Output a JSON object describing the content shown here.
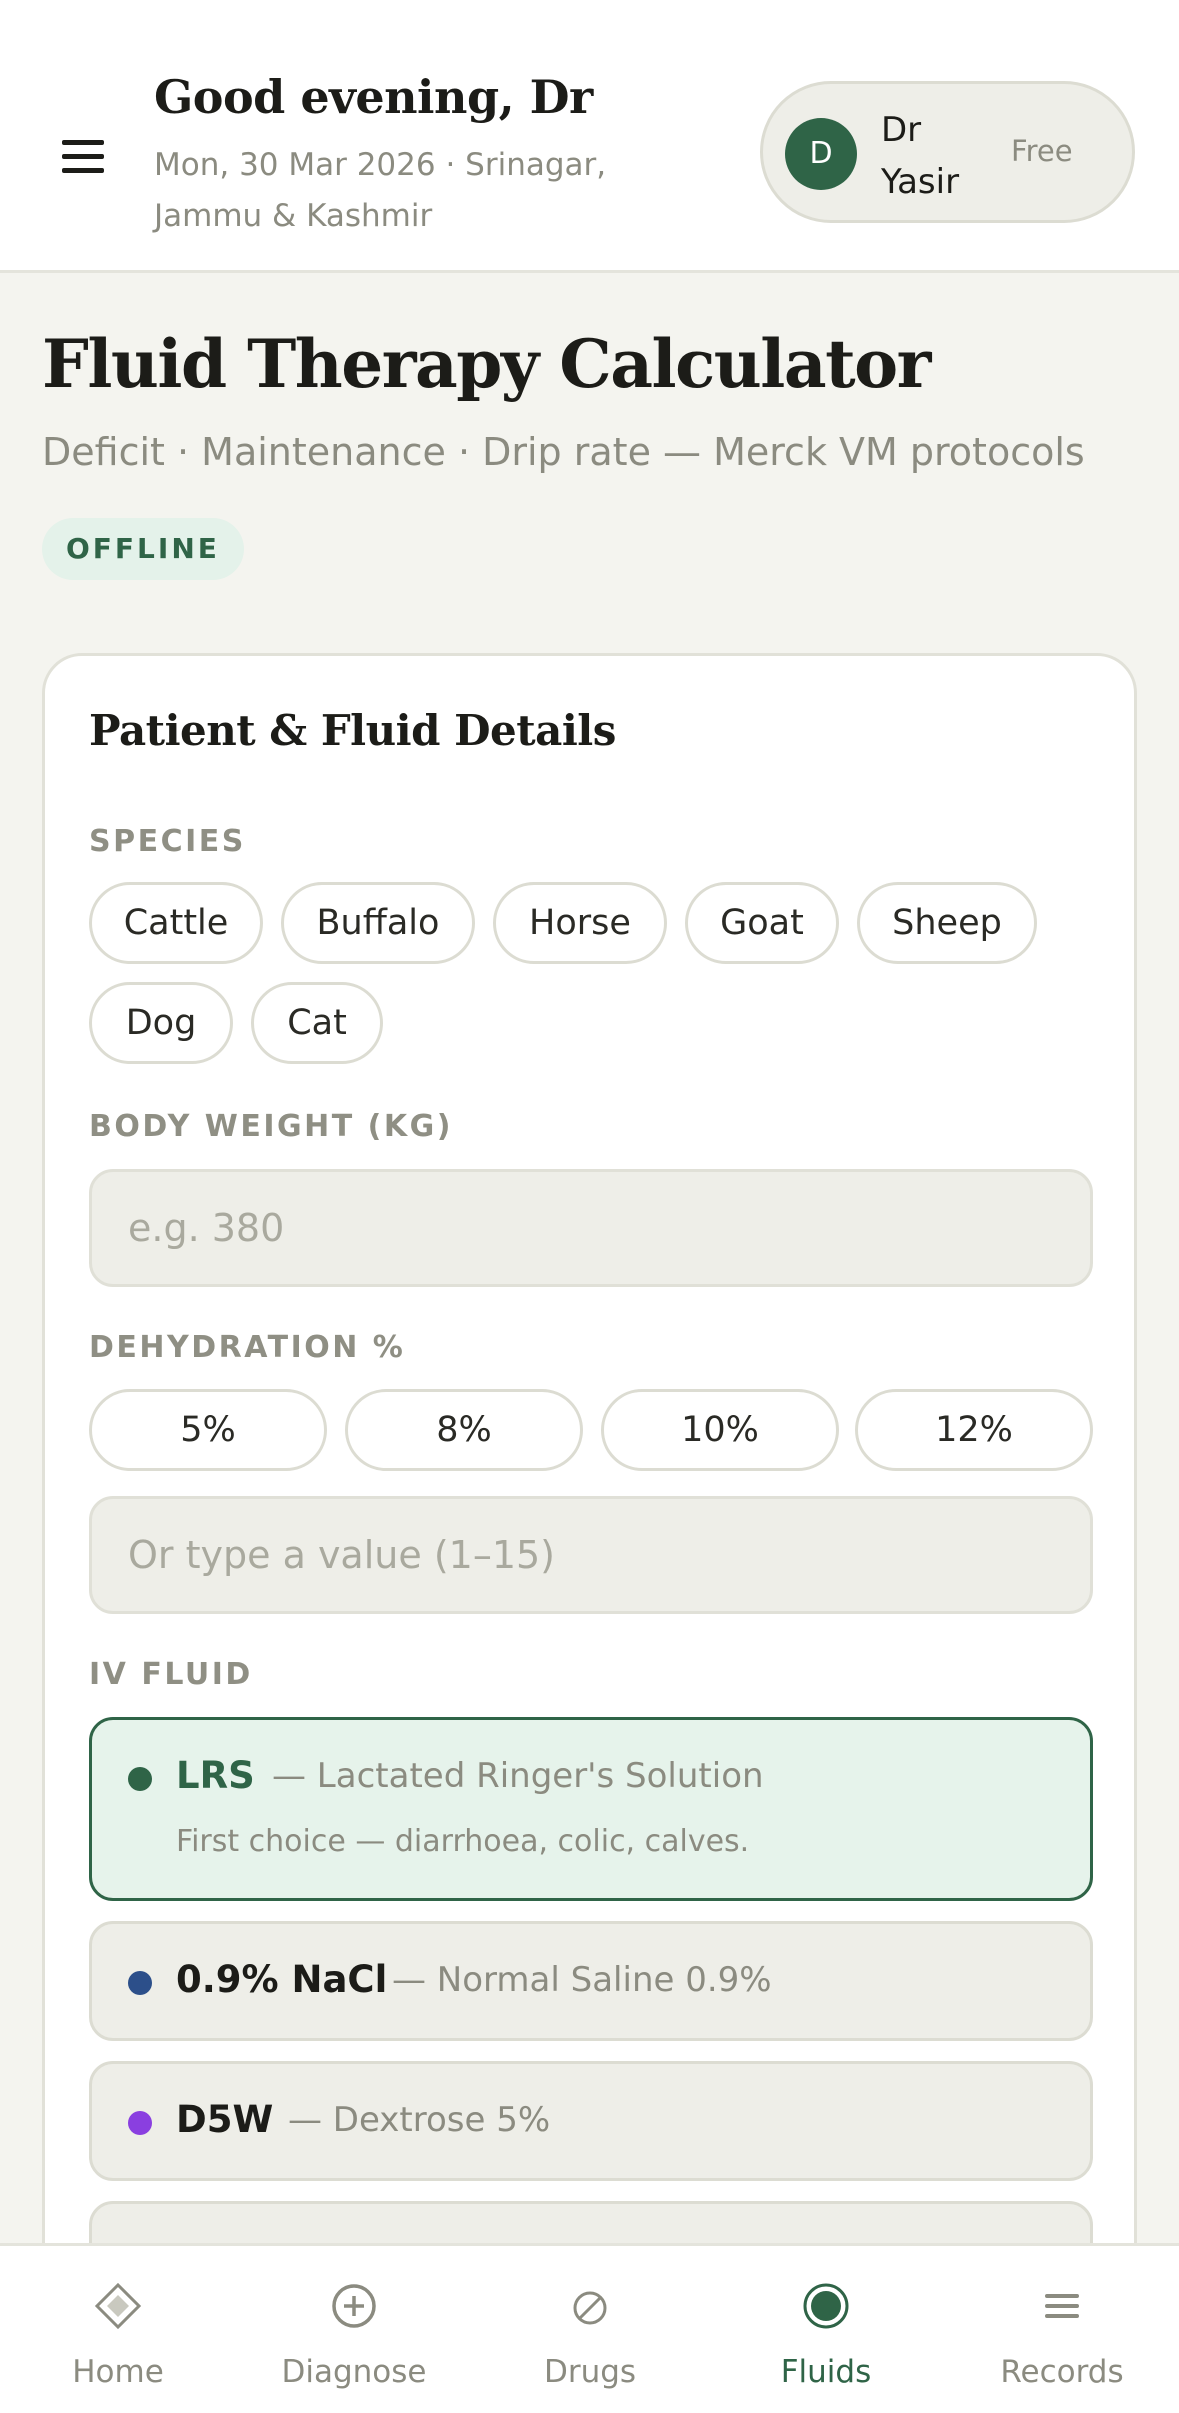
{
  "header": {
    "greeting": "Good evening, Dr",
    "subtitle": "Mon, 30 Mar 2026 · Srinagar, Jammu & Kashmir",
    "profile": {
      "initial": "D",
      "name": "Dr Yasir",
      "plan": "Free"
    }
  },
  "page": {
    "title": "Fluid Therapy Calculator",
    "subtitle": "Deficit · Maintenance · Drip rate — Merck VM protocols",
    "status_badge": "OFFLINE"
  },
  "form": {
    "title": "Patient & Fluid Details",
    "species_label": "SPECIES",
    "species": [
      "Cattle",
      "Buffalo",
      "Horse",
      "Goat",
      "Sheep",
      "Dog",
      "Cat"
    ],
    "weight_label": "BODY WEIGHT (KG)",
    "weight_placeholder": "e.g. 380",
    "dehydration_label": "DEHYDRATION %",
    "dehydration_options": [
      "5%",
      "8%",
      "10%",
      "12%"
    ],
    "dehydration_placeholder": "Or type a value (1–15)",
    "fluid_label": "IV FLUID",
    "fluids": [
      {
        "name": "LRS",
        "desc": "— Lactated Ringer's Solution",
        "note": "First choice — diarrhoea, colic, calves.",
        "color": "#2f6447",
        "selected": true
      },
      {
        "name": "0.9% NaCl",
        "desc": "— Normal Saline 0.9%",
        "color": "#2c4f8a"
      },
      {
        "name": "D5W",
        "desc": "— Dextrose 5%",
        "color": "#8a3fe0"
      }
    ]
  },
  "nav": {
    "items": [
      "Home",
      "Diagnose",
      "Drugs",
      "Fluids",
      "Records"
    ],
    "active": "Fluids"
  },
  "colors": {
    "accent": "#2f6447",
    "background": "#f4f4ef",
    "muted_text": "#8b8b80"
  }
}
